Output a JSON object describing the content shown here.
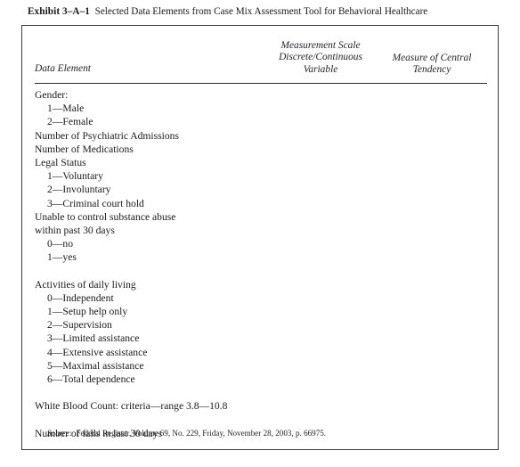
{
  "exhibit": {
    "label": "Exhibit 3–A–1",
    "caption": "Selected Data Elements from Case Mix Assessment Tool for Behavioral Healthcare"
  },
  "table": {
    "columns": [
      {
        "key": "data_element",
        "header": "Data Element"
      },
      {
        "key": "measurement_scale",
        "header_line1": "Measurement Scale",
        "header_line2": "Discrete/Continuous",
        "header_line3": "Variable"
      },
      {
        "key": "central_tendency",
        "header_line1": "Measure of Central",
        "header_line2": "Tendency"
      }
    ],
    "rows": [
      {
        "label": "Gender:",
        "indent": false,
        "scale": "",
        "tendency": ""
      },
      {
        "label": "1—Male",
        "indent": true,
        "scale": "",
        "tendency": ""
      },
      {
        "label": "2—Female",
        "indent": true,
        "scale": "",
        "tendency": ""
      },
      {
        "label": "Number of Psychiatric Admissions",
        "indent": false,
        "scale": "",
        "tendency": ""
      },
      {
        "label": "Number of Medications",
        "indent": false,
        "scale": "",
        "tendency": ""
      },
      {
        "label": "Legal Status",
        "indent": false,
        "scale": "",
        "tendency": ""
      },
      {
        "label": "1—Voluntary",
        "indent": true,
        "scale": "",
        "tendency": ""
      },
      {
        "label": "2—Involuntary",
        "indent": true,
        "scale": "",
        "tendency": ""
      },
      {
        "label": "3—Criminal court hold",
        "indent": true,
        "scale": "",
        "tendency": ""
      },
      {
        "label": "Unable to control substance abuse",
        "indent": false,
        "scale": "",
        "tendency": ""
      },
      {
        "label": "within past 30 days",
        "indent": false,
        "scale": "",
        "tendency": ""
      },
      {
        "label": "0—no",
        "indent": true,
        "scale": "",
        "tendency": ""
      },
      {
        "label": "1—yes",
        "indent": true,
        "scale": "",
        "tendency": ""
      },
      {
        "label": "",
        "indent": false,
        "scale": "",
        "tendency": ""
      },
      {
        "label": "Activities of daily living",
        "indent": false,
        "scale": "",
        "tendency": ""
      },
      {
        "label": "0—Independent",
        "indent": true,
        "scale": "",
        "tendency": ""
      },
      {
        "label": "1—Setup help only",
        "indent": true,
        "scale": "",
        "tendency": ""
      },
      {
        "label": "2—Supervision",
        "indent": true,
        "scale": "",
        "tendency": ""
      },
      {
        "label": "3—Limited assistance",
        "indent": true,
        "scale": "",
        "tendency": ""
      },
      {
        "label": "4—Extensive assistance",
        "indent": true,
        "scale": "",
        "tendency": ""
      },
      {
        "label": "5—Maximal assistance",
        "indent": true,
        "scale": "",
        "tendency": ""
      },
      {
        "label": "6—Total dependence",
        "indent": true,
        "scale": "",
        "tendency": ""
      },
      {
        "label": "",
        "indent": false,
        "scale": "",
        "tendency": ""
      },
      {
        "label": "White Blood Count: criteria—range 3.8—10.8",
        "indent": false,
        "scale": "",
        "tendency": ""
      },
      {
        "label": "",
        "indent": false,
        "scale": "",
        "tendency": ""
      },
      {
        "label": "Number of falls in last 30 days",
        "indent": false,
        "scale": "",
        "tendency": ""
      }
    ]
  },
  "source": {
    "label": "Source:",
    "text": "Federal Register, Volume 69, No. 229, Friday, November 28, 2003, p. 66975."
  }
}
